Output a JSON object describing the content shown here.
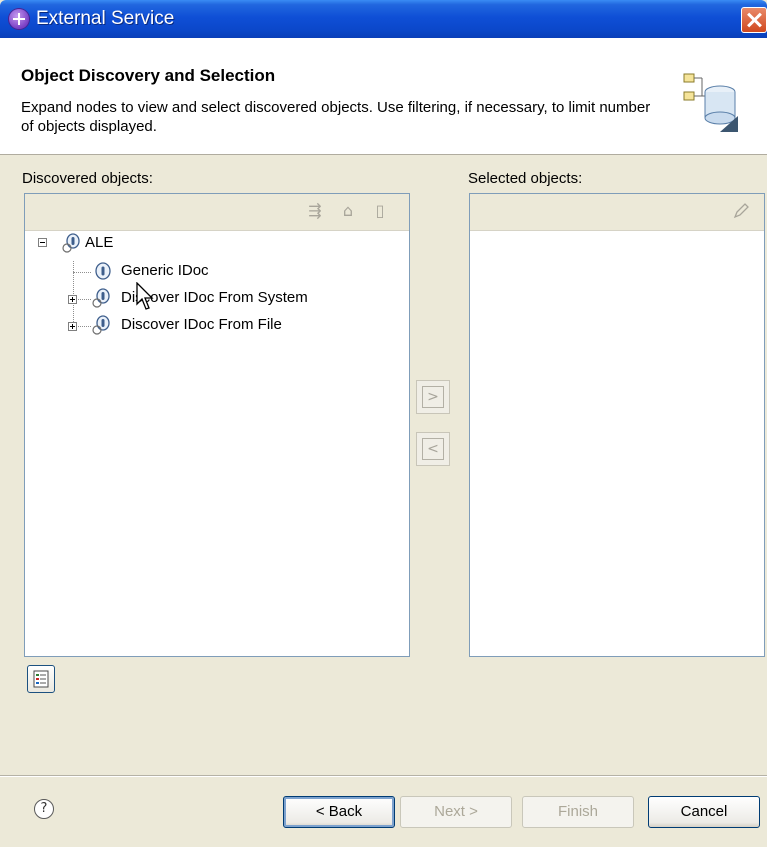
{
  "window": {
    "title": "External Service",
    "close_icon": "close-icon"
  },
  "banner": {
    "title": "Object Discovery and Selection",
    "description": "Expand nodes to view and select discovered objects.  Use filtering, if necessary, to limit number of objects displayed.",
    "graphic_icon": "database-graphic-icon"
  },
  "discovered": {
    "label": "Discovered objects:",
    "toolbar_icons": [
      "filter-icon",
      "edit-query-icon",
      "open-book-icon"
    ],
    "tree": {
      "root": {
        "label": "ALE",
        "expanded": true,
        "icon": "adapter-node-icon"
      },
      "children": [
        {
          "label": "Generic IDoc",
          "icon": "object-node-icon",
          "expandable": false
        },
        {
          "label": "Discover IDoc From System",
          "icon": "adapter-node-icon",
          "expandable": true
        },
        {
          "label": "Discover IDoc From File",
          "icon": "adapter-node-icon",
          "expandable": true
        }
      ]
    }
  },
  "selected": {
    "label": "Selected objects:",
    "toolbar_icons": [
      "pencil-icon"
    ]
  },
  "move": {
    "add_label": ">",
    "remove_label": "<"
  },
  "footer": {
    "help_label": "?",
    "back_label": "< Back",
    "next_label": "Next >",
    "finish_label": "Finish",
    "cancel_label": "Cancel"
  },
  "colors": {
    "titlebar": "#0F4FD6",
    "panel_border": "#7F9DB9",
    "background": "#ECE9D8"
  }
}
